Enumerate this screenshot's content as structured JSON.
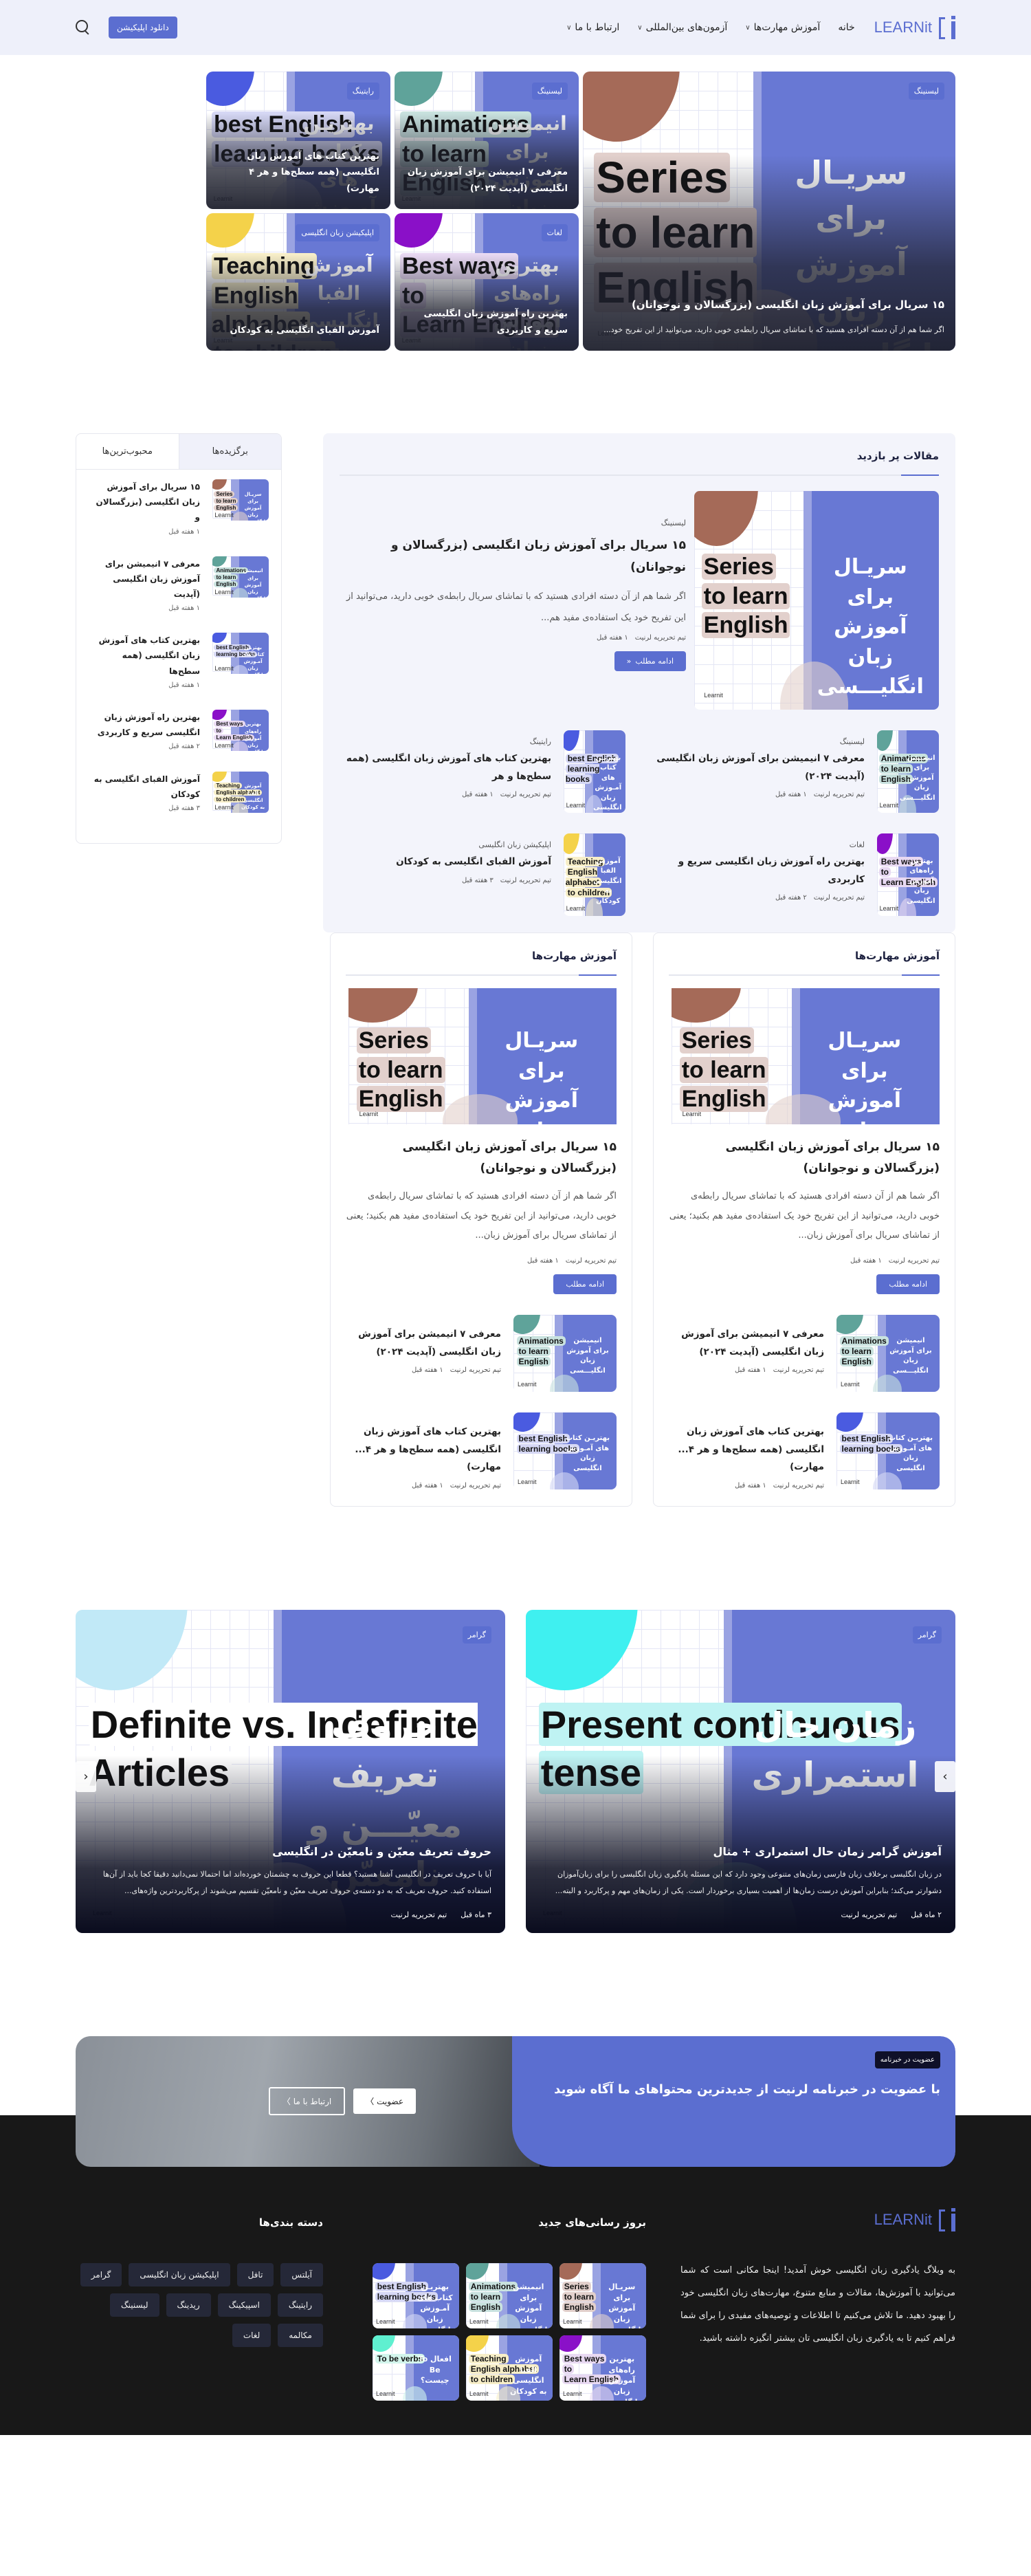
{
  "header": {
    "logo": "LEARNit",
    "nav": [
      {
        "label": "خانه",
        "dropdown": false
      },
      {
        "label": "آموزش مهارت‌ها",
        "dropdown": true
      },
      {
        "label": "آزمون‌های بین‌المللی",
        "dropdown": true
      },
      {
        "label": "ارتباط با ما",
        "dropdown": true
      }
    ],
    "download_button": "دانلود اپلیکیشن",
    "search_icon": "search-icon"
  },
  "colors": {
    "brand": "#5b6ed0",
    "footer_bg": "#181818",
    "badge_dark": "#0f1028",
    "chip_bg": "#252838"
  },
  "hero": {
    "featured": {
      "category": "لیسنینگ",
      "title": "۱۵ سریال برای آموزش زبان انگلیسی (بزرگسالان و نوجوانان)",
      "excerpt": "اگر شما هم از آن دسته افرادی هستید که با تماشای سریال رابطه‌ی خوبی دارید، می‌توانید از این تفریح خود...",
      "thumb": {
        "en": [
          "Series",
          "to learn",
          "English"
        ],
        "fa": "سریـال برای آموزش زبان انگلیـــسی",
        "blob": "#a56a58",
        "hl": "#e2d0cc"
      }
    },
    "cards": [
      {
        "category": "لیسنینگ",
        "title": "معرفی ۷ انیمیشن برای آموزش زبان انگلیسی (آپدیت ۲۰۲۴)",
        "thumb": {
          "en": [
            "Animations",
            "to learn",
            "English"
          ],
          "fa": "انیمیشن برای آموزش زبان انگلیـــسی",
          "blob": "#5fa39a",
          "hl": "#c9e2df"
        }
      },
      {
        "category": "رایتینگ",
        "title": "بهترین کتاب های آموزش زبان انگلیسی (همه سطح‌ها و هر ۴ مهارت)",
        "thumb": {
          "en": [
            "best English",
            " learning books"
          ],
          "fa": "بهتریـن کتاب های آمـوزش زبان انگلیسی",
          "blob": "#4a5be0",
          "hl": "#d6d8f5"
        }
      },
      {
        "category": "لغات",
        "title": "بهترین راه آموزش زبان انگلیسی سریع و کاربردی",
        "thumb": {
          "en": [
            "Best ways",
            " to",
            "Learn English"
          ],
          "fa": "بهترین راه‌های آموزش زبان انگلیسی",
          "blob": "#8a10c8",
          "hl": "#e8d9f2"
        }
      },
      {
        "category": "اپلیکیشن زبان انگلیسی",
        "title": "آموزش الفبای انگلیسی به کودکان",
        "thumb": {
          "en": [
            "Teaching",
            "English alphabet",
            "to children"
          ],
          "fa": "آموزش الفبا انگلیسی به کودکان",
          "blob": "#f4d24a",
          "hl": "#f7eec8"
        }
      }
    ]
  },
  "popular": {
    "title": "مقالات پر بازدید",
    "featured": {
      "category": "لیسنینگ",
      "title": "۱۵ سریال برای آموزش زبان انگلیسی (بزرگسالان و نوجوانان)",
      "excerpt": "اگر شما هم از آن دسته افرادی هستید که با تماشای سریال رابطه‌ی خوبی دارید، می‌توانید از این تفریح خود یک استفاده‌ی مفید هم...",
      "author": "تیم تحریریه لرنیت",
      "date": "۱ هفته قبل",
      "button": "ادامه مطلب",
      "thumb": {
        "en": [
          "Series",
          "to learn",
          "English"
        ],
        "fa": "سریـال برای آموزش زبان انگلیـــسی",
        "blob": "#a56a58",
        "hl": "#e2d0cc"
      }
    },
    "items": [
      {
        "category": "لیسنینگ",
        "title": "معرفی ۷ انیمیشن برای آموزش زبان انگلیسی (آپدیت ۲۰۲۴)",
        "author": "تیم تحریریه لرنیت",
        "date": "۱ هفته قبل",
        "thumb": {
          "en": [
            "Animations",
            "to learn",
            "English"
          ],
          "fa": "انیمیشن برای آموزش زبان انگلیـــسی",
          "blob": "#5fa39a",
          "hl": "#c9e2df"
        }
      },
      {
        "category": "رایتینگ",
        "title": "بهترین کتاب های آموزش زبان انگلیسی (همه سطح‌ها و هر",
        "author": "تیم تحریریه لرنیت",
        "date": "۱ هفته قبل",
        "thumb": {
          "en": [
            "best English",
            " learning books"
          ],
          "fa": "بهتریـن کتاب های آمـوزش زبان انگلیسی",
          "blob": "#4a5be0",
          "hl": "#d6d8f5"
        }
      },
      {
        "category": "لغات",
        "title": "بهترین راه آموزش زبان انگلیسی سریع و کاربردی",
        "author": "تیم تحریریه لرنیت",
        "date": "۲ هفته قبل",
        "thumb": {
          "en": [
            "Best ways",
            " to",
            "Learn English"
          ],
          "fa": "بهترین راه‌های آموزش زبان انگلیسی",
          "blob": "#8a10c8",
          "hl": "#e8d9f2"
        }
      },
      {
        "category": "اپلیکیشن زبان انگلیسی",
        "title": "آموزش الفبای انگلیسی به کودکان",
        "author": "تیم تحریریه لرنیت",
        "date": "۳ هفته قبل",
        "thumb": {
          "en": [
            "Teaching",
            "English alphabet",
            "to children"
          ],
          "fa": "آموزش الفبا انگلیسی به کودکان",
          "blob": "#f4d24a",
          "hl": "#f7eec8"
        }
      }
    ]
  },
  "sidebar": {
    "tabs": [
      {
        "label": "برگزیده‌ها",
        "active": true
      },
      {
        "label": "محبوب‌ترین‌ها",
        "active": false
      }
    ],
    "items": [
      {
        "title": "۱۵ سریال برای آموزش زبان انگلیسی (بزرگسالان و",
        "date": "۱ هفته قبل",
        "thumb": {
          "en": [
            "Series",
            "to learn",
            "English"
          ],
          "fa": "سریـال برای آموزش زبان انگلیـــسی",
          "blob": "#a56a58",
          "hl": "#e2d0cc"
        }
      },
      {
        "title": "معرفی ۷ انیمیشن برای آموزش زبان انگلیسی (آپدیت",
        "date": "۱ هفته قبل",
        "thumb": {
          "en": [
            "Animations",
            "to learn",
            "English"
          ],
          "fa": "انیمیشن برای آموزش زبان انگلیـــسی",
          "blob": "#5fa39a",
          "hl": "#c9e2df"
        }
      },
      {
        "title": "بهترین کتاب های آموزش زبان انگلیسی (همه سطح‌ها",
        "date": "۱ هفته قبل",
        "thumb": {
          "en": [
            "best English",
            " learning books"
          ],
          "fa": "بهتریـن کتاب های آمـوزش زبان انگلیسی",
          "blob": "#4a5be0",
          "hl": "#d6d8f5"
        }
      },
      {
        "title": "بهترین راه آموزش زبان انگلیسی سریع و کاربردی",
        "date": "۲ هفته قبل",
        "thumb": {
          "en": [
            "Best ways",
            " to",
            "Learn English"
          ],
          "fa": "بهترین راه‌های آموزش زبان انگلیسی",
          "blob": "#8a10c8",
          "hl": "#e8d9f2"
        }
      },
      {
        "title": "آموزش الفبای انگلیسی به کودکان",
        "date": "۳ هفته قبل",
        "thumb": {
          "en": [
            "Teaching",
            "English alphabet",
            "to children"
          ],
          "fa": "آموزش الفبا انگلیسی به کودکان",
          "blob": "#f4d24a",
          "hl": "#f7eec8"
        }
      }
    ]
  },
  "skills": [
    {
      "title": "آموزش مهارت‌ها",
      "featured": {
        "title": "۱۵ سریال برای آموزش زبان انگلیسی (بزرگسالان و نوجوانان)",
        "excerpt": "اگر شما هم از آن دسته افرادی هستید که با تماشای سریال رابطه‌ی خوبی دارید، می‌توانید از این تفریح خود یک استفاده‌ی مفید هم بکنید؛ یعنی از تماشای سریال برای آموزش زبان...",
        "author": "تیم تحریریه لرنیت",
        "date": "۱ هفته قبل",
        "button": "ادامه مطلب",
        "thumb": {
          "en": [
            "Series",
            "to learn",
            "English"
          ],
          "fa": "سریـال برای آموزش زبان انگلیـــسی",
          "blob": "#a56a58",
          "hl": "#e2d0cc"
        }
      },
      "items": [
        {
          "title": "معرفی ۷ انیمیشن برای آموزش زبان انگلیسی (آپدیت ۲۰۲۴)",
          "author": "تیم تحریریه لرنیت",
          "date": "۱ هفته قبل",
          "thumb": {
            "en": [
              "Animations",
              "to learn",
              "English"
            ],
            "fa": "انیمیشن برای آموزش زبان انگلیـــسی",
            "blob": "#5fa39a",
            "hl": "#c9e2df"
          }
        },
        {
          "title": "بهترین کتاب های آموزش زبان انگلیسی (همه سطح‌ها و هر ۴... مهارت)",
          "author": "تیم تحریریه لرنیت",
          "date": "۱ هفته قبل",
          "thumb": {
            "en": [
              "best English",
              " learning books"
            ],
            "fa": "بهتریـن کتاب های آمـوزش زبان انگلیسی",
            "blob": "#4a5be0",
            "hl": "#d6d8f5"
          }
        }
      ]
    },
    {
      "title": "آموزش مهارت‌ها",
      "featured": {
        "title": "۱۵ سریال برای آموزش زبان انگلیسی (بزرگسالان و نوجوانان)",
        "excerpt": "اگر شما هم از آن دسته افرادی هستید که با تماشای سریال رابطه‌ی خوبی دارید، می‌توانید از این تفریح خود یک استفاده‌ی مفید هم بکنید؛ یعنی از تماشای سریال برای آموزش زبان...",
        "author": "تیم تحریریه لرنیت",
        "date": "۱ هفته قبل",
        "button": "ادامه مطلب",
        "thumb": {
          "en": [
            "Series",
            "to learn",
            "English"
          ],
          "fa": "سریـال برای آموزش زبان انگلیـــسی",
          "blob": "#a56a58",
          "hl": "#e2d0cc"
        }
      },
      "items": [
        {
          "title": "معرفی ۷ انیمیشن برای آموزش زبان انگلیسی (آپدیت ۲۰۲۴)",
          "author": "تیم تحریریه لرنیت",
          "date": "۱ هفته قبل",
          "thumb": {
            "en": [
              "Animations",
              "to learn",
              "English"
            ],
            "fa": "انیمیشن برای آموزش زبان انگلیـــسی",
            "blob": "#5fa39a",
            "hl": "#c9e2df"
          }
        },
        {
          "title": "بهترین کتاب های آموزش زبان انگلیسی (همه سطح‌ها و هر ۴... مهارت)",
          "author": "تیم تحریریه لرنیت",
          "date": "۱ هفته قبل",
          "thumb": {
            "en": [
              "best English",
              " learning books"
            ],
            "fa": "بهتریـن کتاب های آمـوزش زبان انگلیسی",
            "blob": "#4a5be0",
            "hl": "#d6d8f5"
          }
        }
      ]
    }
  ],
  "slider": {
    "slides": [
      {
        "category": "گرامر",
        "title": "آموزش گرامر زمان حال استمراری + مثال",
        "excerpt": "در زبان انگلیسی برخلاف زبان فارسی زمان‌های متنوعی وجود دارد که این مسئله یادگیری زبان انگلیسی را برای زبان‌آموزان دشوارتر می‌کند؛ بنابراین آموزش درست زمان‌ها از اهمیت بسیاری برخوردار است. یکی از زمان‌های مهم و پرکاربرد و البته...",
        "date": "۲ ماه قبل",
        "author": "تیم تحریریه لرنیت",
        "thumb": {
          "en": [
            "Present continuous",
            "tense"
          ],
          "fa": "زمان حال استمراری",
          "blob": "#3ff0f0",
          "hl": "#bff3f3"
        }
      },
      {
        "category": "گرامر",
        "title": "حروف تعریف معیّن و نامعیّن در انگلیسی",
        "excerpt": "آیا با حروف تعریف در انگلیسی آشنا هستید؟ قطعا این حروف به چشمتان خورده‌اند اما احتمالا نمی‌دانید دقیقا کجا باید از آن‌ها استفاده کنید. حروف تعریف که به دو دسته‌ی حروف تعریف معیّن و نامعیّن تقسیم می‌شوند از پرکاربردترین واژه‌های...",
        "date": "۳ ماه قبل",
        "author": "تیم تحریریه لرنیت",
        "thumb": {
          "en": [
            "Definite vs. Indefinite Articles"
          ],
          "fa": "حروف تعریف معیّـــن و نامعیّن",
          "blob": "#c1e9f7",
          "hl": "#ffffff"
        }
      }
    ],
    "next_icon": "chevron-right-icon",
    "prev_icon": "chevron-left-icon"
  },
  "newsletter": {
    "badge": "عضویت در خبرنامه",
    "title": "با عضویت در خبرنامه لرنیت از جدیدترین محتواهای ما آگاه شوید",
    "join_button": "عضویت",
    "contact_button": "ارتباط با ما"
  },
  "footer": {
    "logo": "LEARNit",
    "description": "به وبلاگ یادگیری زبان انگلیسی خوش آمدید! اینجا مکانی است که شما می‌توانید با آموزش‌ها، مقالات و منابع متنوع، مهارت‌های زبان انگلیسی خود را بهبود دهید. ما تلاش می‌کنیم تا اطلاعات و توصیه‌های مفیدی را برای شما فراهم کنیم تا به یادگیری زبان انگلیسی تان بیشتر انگیزه داشته باشید.",
    "news_title": "بروز رسانی‌های جدید",
    "news_thumbs": [
      {
        "en": [
          "Series",
          "to learn",
          "English"
        ],
        "fa": "سریـال برای آموزش زبان انگلیـــسی",
        "blob": "#a56a58",
        "hl": "#e2d0cc"
      },
      {
        "en": [
          "Animations",
          "to learn",
          "English"
        ],
        "fa": "انیمیشن برای آموزش زبان انگلیـــسی",
        "blob": "#5fa39a",
        "hl": "#c9e2df"
      },
      {
        "en": [
          "best English",
          " learning books"
        ],
        "fa": "بهتریـن کتاب های آمـوزش زبان انگلیسی",
        "blob": "#4a5be0",
        "hl": "#d6d8f5"
      },
      {
        "en": [
          "Best ways",
          " to",
          "Learn English"
        ],
        "fa": "بهترین راه‌های آموزش زبان انگلیسی",
        "blob": "#8a10c8",
        "hl": "#e8d9f2"
      },
      {
        "en": [
          "Teaching",
          "English alphabet",
          "to children"
        ],
        "fa": "آموزش الفبا انگلیسی به کودکان",
        "blob": "#f4d24a",
        "hl": "#f7eec8"
      },
      {
        "en": [
          "To be verbs"
        ],
        "fa": "افعال To Be چیست؟",
        "blob": "#5ff0d0",
        "hl": "#d3f5ec"
      }
    ],
    "cats_title": "دسته بندی‌ها",
    "categories": [
      "آیلتس",
      "تافل",
      "اپلیکیشن زبان انگلیسی",
      "گرامر",
      "رایتینگ",
      "اسپیکینگ",
      "ریدینگ",
      "لیسنینگ",
      "مکالمه",
      "لغات"
    ]
  }
}
